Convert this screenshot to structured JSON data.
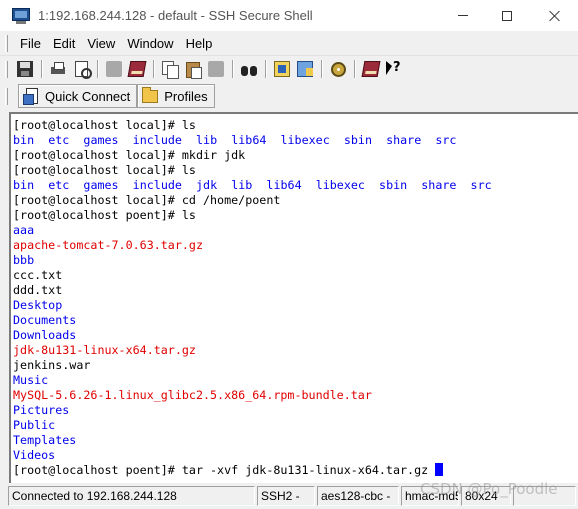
{
  "window": {
    "title": "1:192.168.244.128 - default - SSH Secure Shell"
  },
  "menu": {
    "items": [
      "File",
      "Edit",
      "View",
      "Window",
      "Help"
    ]
  },
  "profile_bar": {
    "quick_connect": "Quick Connect",
    "profiles": "Profiles"
  },
  "terminal": {
    "lines": [
      [
        {
          "t": "[root@localhost local]# ls",
          "c": "black"
        }
      ],
      [
        {
          "t": "bin",
          "c": "blue"
        },
        {
          "t": "  ",
          "c": "black"
        },
        {
          "t": "etc",
          "c": "blue"
        },
        {
          "t": "  ",
          "c": "black"
        },
        {
          "t": "games",
          "c": "blue"
        },
        {
          "t": "  ",
          "c": "black"
        },
        {
          "t": "include",
          "c": "blue"
        },
        {
          "t": "  ",
          "c": "black"
        },
        {
          "t": "lib",
          "c": "blue"
        },
        {
          "t": "  ",
          "c": "black"
        },
        {
          "t": "lib64",
          "c": "blue"
        },
        {
          "t": "  ",
          "c": "black"
        },
        {
          "t": "libexec",
          "c": "blue"
        },
        {
          "t": "  ",
          "c": "black"
        },
        {
          "t": "sbin",
          "c": "blue"
        },
        {
          "t": "  ",
          "c": "black"
        },
        {
          "t": "share",
          "c": "blue"
        },
        {
          "t": "  ",
          "c": "black"
        },
        {
          "t": "src",
          "c": "blue"
        }
      ],
      [
        {
          "t": "[root@localhost local]# mkdir jdk",
          "c": "black"
        }
      ],
      [
        {
          "t": "[root@localhost local]# ls",
          "c": "black"
        }
      ],
      [
        {
          "t": "bin",
          "c": "blue"
        },
        {
          "t": "  ",
          "c": "black"
        },
        {
          "t": "etc",
          "c": "blue"
        },
        {
          "t": "  ",
          "c": "black"
        },
        {
          "t": "games",
          "c": "blue"
        },
        {
          "t": "  ",
          "c": "black"
        },
        {
          "t": "include",
          "c": "blue"
        },
        {
          "t": "  ",
          "c": "black"
        },
        {
          "t": "jdk",
          "c": "blue"
        },
        {
          "t": "  ",
          "c": "black"
        },
        {
          "t": "lib",
          "c": "blue"
        },
        {
          "t": "  ",
          "c": "black"
        },
        {
          "t": "lib64",
          "c": "blue"
        },
        {
          "t": "  ",
          "c": "black"
        },
        {
          "t": "libexec",
          "c": "blue"
        },
        {
          "t": "  ",
          "c": "black"
        },
        {
          "t": "sbin",
          "c": "blue"
        },
        {
          "t": "  ",
          "c": "black"
        },
        {
          "t": "share",
          "c": "blue"
        },
        {
          "t": "  ",
          "c": "black"
        },
        {
          "t": "src",
          "c": "blue"
        }
      ],
      [
        {
          "t": "[root@localhost local]# cd /home/poent",
          "c": "black"
        }
      ],
      [
        {
          "t": "[root@localhost poent]# ls",
          "c": "black"
        }
      ],
      [
        {
          "t": "aaa",
          "c": "blue"
        }
      ],
      [
        {
          "t": "apache-tomcat-7.0.63.tar.gz",
          "c": "red"
        }
      ],
      [
        {
          "t": "bbb",
          "c": "blue"
        }
      ],
      [
        {
          "t": "ccc.txt",
          "c": "black"
        }
      ],
      [
        {
          "t": "ddd.txt",
          "c": "black"
        }
      ],
      [
        {
          "t": "Desktop",
          "c": "blue"
        }
      ],
      [
        {
          "t": "Documents",
          "c": "blue"
        }
      ],
      [
        {
          "t": "Downloads",
          "c": "blue"
        }
      ],
      [
        {
          "t": "jdk-8u131-linux-x64.tar.gz",
          "c": "red"
        }
      ],
      [
        {
          "t": "jenkins.war",
          "c": "black"
        }
      ],
      [
        {
          "t": "Music",
          "c": "blue"
        }
      ],
      [
        {
          "t": "MySQL-5.6.26-1.linux_glibc2.5.x86_64.rpm-bundle.tar",
          "c": "red"
        }
      ],
      [
        {
          "t": "Pictures",
          "c": "blue"
        }
      ],
      [
        {
          "t": "Public",
          "c": "blue"
        }
      ],
      [
        {
          "t": "Templates",
          "c": "blue"
        }
      ],
      [
        {
          "t": "Videos",
          "c": "blue"
        }
      ],
      [
        {
          "t": "[root@localhost poent]# tar -xvf jdk-8u131-linux-x64.tar.gz ",
          "c": "black",
          "cursor": true
        }
      ]
    ],
    "colors": {
      "black": "#000000",
      "blue": "#0000ee",
      "red": "#e00000",
      "cursor": "#0000ff"
    }
  },
  "status": {
    "connection": "Connected to 192.168.244.128",
    "protocol": "SSH2 -",
    "cipher": "aes128-cbc -",
    "mac": "hmac-md5 -",
    "size": "80x24"
  },
  "watermark": "CSDN @Po_Poodle"
}
